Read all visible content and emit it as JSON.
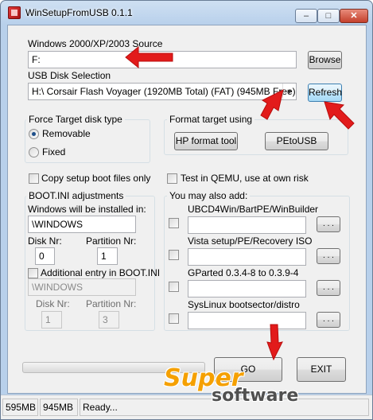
{
  "window": {
    "title": "WinSetupFromUSB 0.1.1",
    "caption_buttons": {
      "minimize": "–",
      "maximize": "□",
      "close": "✕"
    }
  },
  "source": {
    "label": "Windows 2000/XP/2003 Source",
    "value": "F:",
    "browse_label": "Browse"
  },
  "usb": {
    "label": "USB Disk Selection",
    "selected": "H:\\ Corsair Flash Voyager (1920MB Total) (FAT) (945MB Free)",
    "refresh_label": "Refresh"
  },
  "force_type": {
    "title": "Force Target disk type",
    "removable_label": "Removable",
    "fixed_label": "Fixed",
    "selected": "Removable"
  },
  "format": {
    "title": "Format target using",
    "hp_label": "HP format tool",
    "petousb_label": "PEtoUSB"
  },
  "options": {
    "copy_boot_label": "Copy setup boot files only",
    "qemu_label": "Test in QEMU, use at own risk"
  },
  "bootini": {
    "title": "BOOT.INI adjustments",
    "install_label": "Windows will be installed in:",
    "install_value": "\\WINDOWS",
    "disk_label": "Disk Nr:",
    "disk_value": "0",
    "partition_label": "Partition Nr:",
    "partition_value": "1",
    "additional_label": "Additional entry in BOOT.INI",
    "additional_value": "\\WINDOWS",
    "disk2_label": "Disk Nr:",
    "disk2_value": "1",
    "partition2_label": "Partition Nr:",
    "partition2_value": "3"
  },
  "also_add": {
    "title": "You may also add:",
    "items": [
      {
        "label": "UBCD4Win/BartPE/WinBuilder",
        "browse": ". . ."
      },
      {
        "label": "Vista setup/PE/Recovery ISO",
        "browse": ". . ."
      },
      {
        "label": "GParted 0.3.4-8 to 0.3.9-4",
        "browse": ". . ."
      },
      {
        "label": "SysLinux bootsector/distro",
        "browse": ". . ."
      }
    ]
  },
  "actions": {
    "go_label": "GO",
    "exit_label": "EXIT",
    "progress": 0
  },
  "status": {
    "total": "595MB",
    "free": "945MB",
    "message": "Ready..."
  },
  "watermark": {
    "line1": "Super",
    "line2": "software"
  },
  "colors": {
    "annotation_arrow": "#e21b1b",
    "title_gradient": "#b8d0eb",
    "watermark_orange": "#f5a000"
  }
}
